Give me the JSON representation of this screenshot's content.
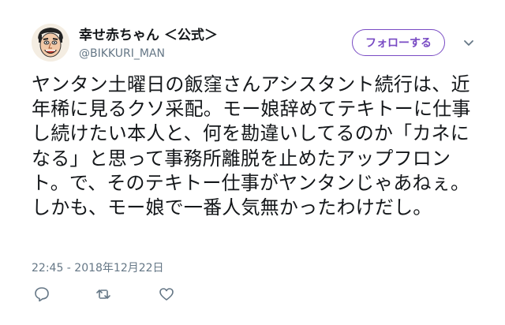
{
  "user": {
    "display_name": "幸せ赤ちゃん ＜公式＞",
    "handle": "@BIKKURI_MAN"
  },
  "follow_button": {
    "label": "フォローする"
  },
  "tweet": {
    "text": "ヤンタン土曜日の飯窪さんアシスタント続行は、近年稀に見るクソ采配。モー娘辞めてテキトーに仕事し続けたい本人と、何を勘違いしてるのか「カネになる」と思って事務所離脱を止めたアップフロント。で、そのテキトー仕事がヤンタンじゃあねぇ。しかも、モー娘で一番人気無かったわけだし。",
    "timestamp": "22:45 - 2018年12月22日"
  },
  "actions": {
    "reply_icon": "reply-icon",
    "retweet_icon": "retweet-icon",
    "like_icon": "heart-icon"
  },
  "colors": {
    "accent": "#794bc4",
    "secondary_text": "#657786",
    "icon": "#657786"
  }
}
